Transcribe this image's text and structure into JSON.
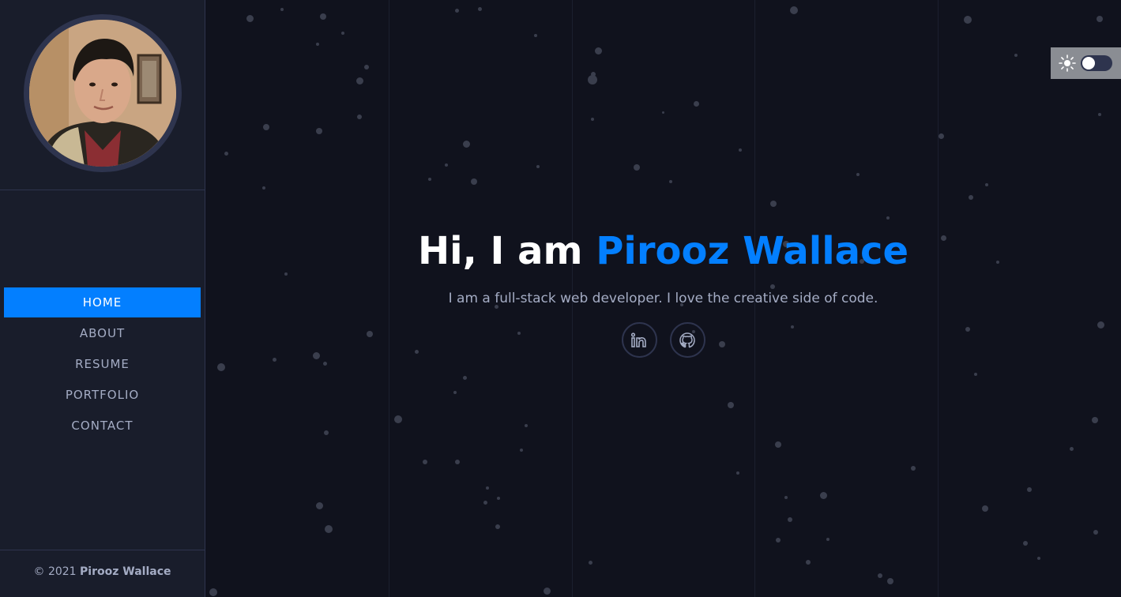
{
  "profile": {
    "avatar_alt": "profile photo"
  },
  "nav": {
    "items": [
      {
        "label": "HOME",
        "active": true
      },
      {
        "label": "ABOUT",
        "active": false
      },
      {
        "label": "RESUME",
        "active": false
      },
      {
        "label": "PORTFOLIO",
        "active": false
      },
      {
        "label": "CONTACT",
        "active": false
      }
    ]
  },
  "footer": {
    "copyright_prefix": "© 2021",
    "copyright_name": "Pirooz Wallace"
  },
  "hero": {
    "greeting": "Hi, I am",
    "name": "Pirooz Wallace",
    "tagline": "I am a full-stack web developer. I love the creative side of code.",
    "socials": [
      {
        "icon": "linkedin-icon"
      },
      {
        "icon": "github-icon"
      }
    ]
  },
  "theme": {
    "icon": "sun-icon",
    "dark_mode": true
  },
  "colors": {
    "accent": "#037fff",
    "sidebar_bg": "#191d2b",
    "main_bg": "#10121d",
    "text_muted": "#a4acc4",
    "border": "#2e344e"
  }
}
